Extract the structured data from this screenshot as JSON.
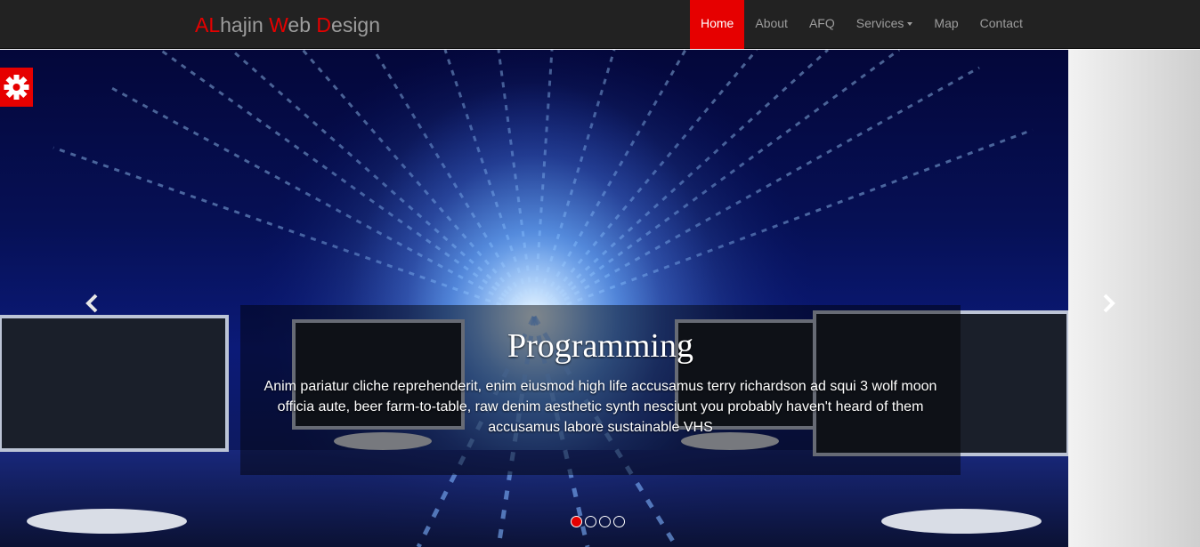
{
  "brand": {
    "parts": [
      {
        "text": "AL",
        "highlight": true
      },
      {
        "text": "hajin ",
        "highlight": false
      },
      {
        "text": "W",
        "highlight": true
      },
      {
        "text": "eb ",
        "highlight": false
      },
      {
        "text": "D",
        "highlight": true
      },
      {
        "text": "esign",
        "highlight": false
      }
    ]
  },
  "nav": {
    "items": [
      {
        "label": "Home",
        "active": true
      },
      {
        "label": "About",
        "active": false
      },
      {
        "label": "AFQ",
        "active": false
      },
      {
        "label": "Services",
        "active": false,
        "dropdown": true
      },
      {
        "label": "Map",
        "active": false
      },
      {
        "label": "Contact",
        "active": false
      }
    ]
  },
  "carousel": {
    "caption_title": "Programming",
    "caption_text": "Anim pariatur cliche reprehenderit, enim eiusmod high life accusamus terry richardson ad squi 3 wolf moon officia aute, beer farm-to-table, raw denim aesthetic synth nesciunt you probably haven't heard of them accusamus labore sustainable VHS",
    "slide_count": 4,
    "active_slide": 1,
    "prev_icon": "chevron-left-icon",
    "next_icon": "chevron-right-icon"
  },
  "settings": {
    "icon": "gear-icon"
  },
  "colors": {
    "accent": "#e60000",
    "navbar": "#222222",
    "nav_text": "#9d9d9d"
  }
}
